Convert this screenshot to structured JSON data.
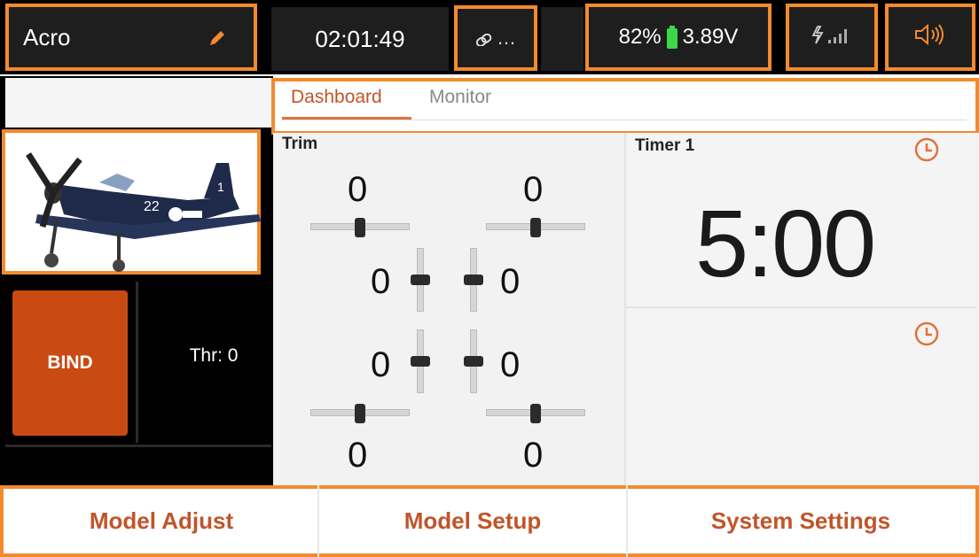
{
  "header": {
    "model_name": "Acro",
    "time": "02:01:49",
    "link": "…",
    "battery_percent": "82%",
    "battery_voltage": "3.89V"
  },
  "tabs": [
    {
      "label": "Dashboard",
      "active": true
    },
    {
      "label": "Monitor",
      "active": false
    }
  ],
  "left": {
    "bind_label": "BIND",
    "throttle_label": "Thr: 0"
  },
  "trim": {
    "title": "Trim",
    "top_left": "0",
    "top_right": "0",
    "mid_left_upper": "0",
    "mid_right_upper": "0",
    "mid_left_lower": "0",
    "mid_right_lower": "0",
    "bottom_left": "0",
    "bottom_right": "0"
  },
  "timer": {
    "title": "Timer 1",
    "value": "5:00"
  },
  "footer": {
    "model_adjust": "Model Adjust",
    "model_setup": "Model Setup",
    "system_settings": "System Settings"
  },
  "colors": {
    "accent": "#f28a2e",
    "bind": "#c94a12",
    "footer_text": "#c0552a",
    "battery": "#3dd84a"
  }
}
